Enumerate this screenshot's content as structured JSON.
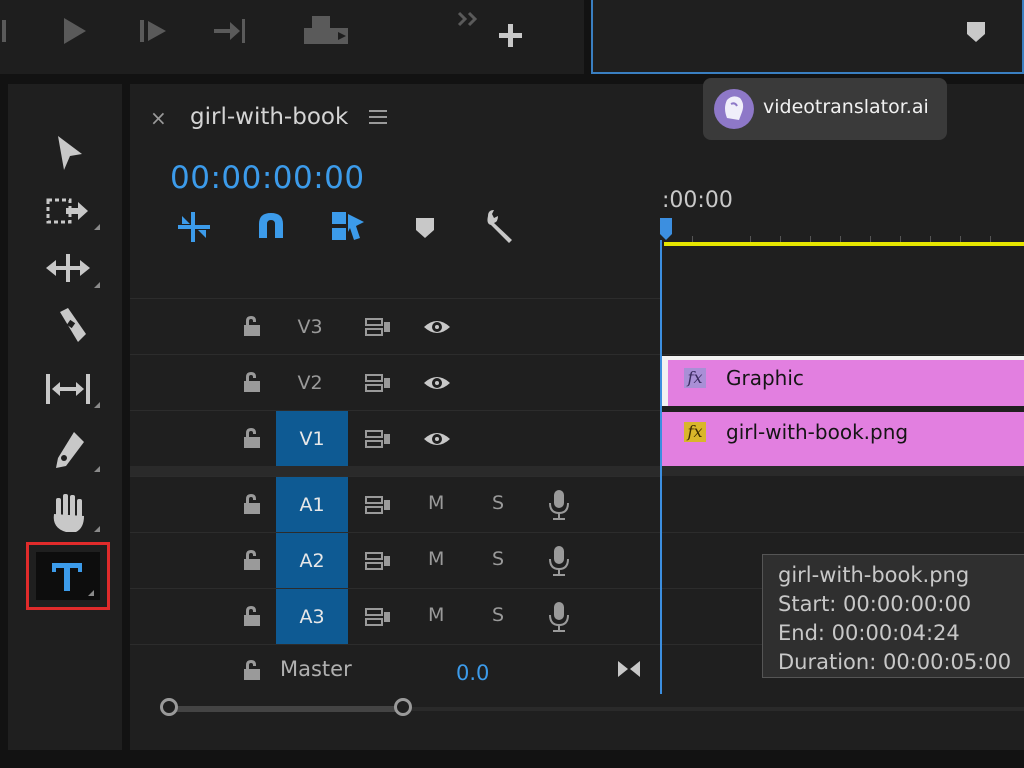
{
  "top_controls": {
    "icons": [
      "step-forward-icon",
      "play-icon",
      "step-frame-icon",
      "go-to-out-icon",
      "export-frame-icon",
      "more-chevrons-icon",
      "add-button-icon"
    ]
  },
  "watermark": {
    "text": "videotranslator.ai",
    "icon": "face-logo-icon"
  },
  "tools": [
    "selection-tool",
    "track-select-tool",
    "ripple-edit-tool",
    "razor-tool",
    "slip-tool",
    "pen-tool",
    "hand-tool",
    "type-tool"
  ],
  "sequence": {
    "close_glyph": "×",
    "name": "girl-with-book",
    "timecode": "00:00:00:00",
    "ruler_start": ":00:00",
    "toolbar_icons": [
      "nest-icon",
      "snap-magnet-icon",
      "linked-selection-icon",
      "add-marker-icon",
      "settings-wrench-icon"
    ]
  },
  "tracks": {
    "video": [
      {
        "name": "V3",
        "selected": false
      },
      {
        "name": "V2",
        "selected": false
      },
      {
        "name": "V1",
        "selected": true
      }
    ],
    "audio": [
      {
        "name": "A1",
        "selected": true,
        "mute": "M",
        "solo": "S"
      },
      {
        "name": "A2",
        "selected": true,
        "mute": "M",
        "solo": "S"
      },
      {
        "name": "A3",
        "selected": true,
        "mute": "M",
        "solo": "S"
      }
    ],
    "master": {
      "label": "Master",
      "value": "0.0"
    }
  },
  "clips": [
    {
      "track": "V2",
      "label": "Graphic",
      "fx": "fx"
    },
    {
      "track": "V1",
      "label": "girl-with-book.png",
      "fx": "fx"
    }
  ],
  "tooltip": {
    "name": "girl-with-book.png",
    "start": "Start: 00:00:00:00",
    "end": "End: 00:00:04:24",
    "duration": "Duration: 00:00:05:00"
  },
  "colors": {
    "timecode": "#3c9bea",
    "selected_track": "#0e5a93",
    "clip": "#e27fe0",
    "playhead": "#3c8fe0",
    "work_area": "#e6e600",
    "highlight_box": "#e02b2b"
  }
}
